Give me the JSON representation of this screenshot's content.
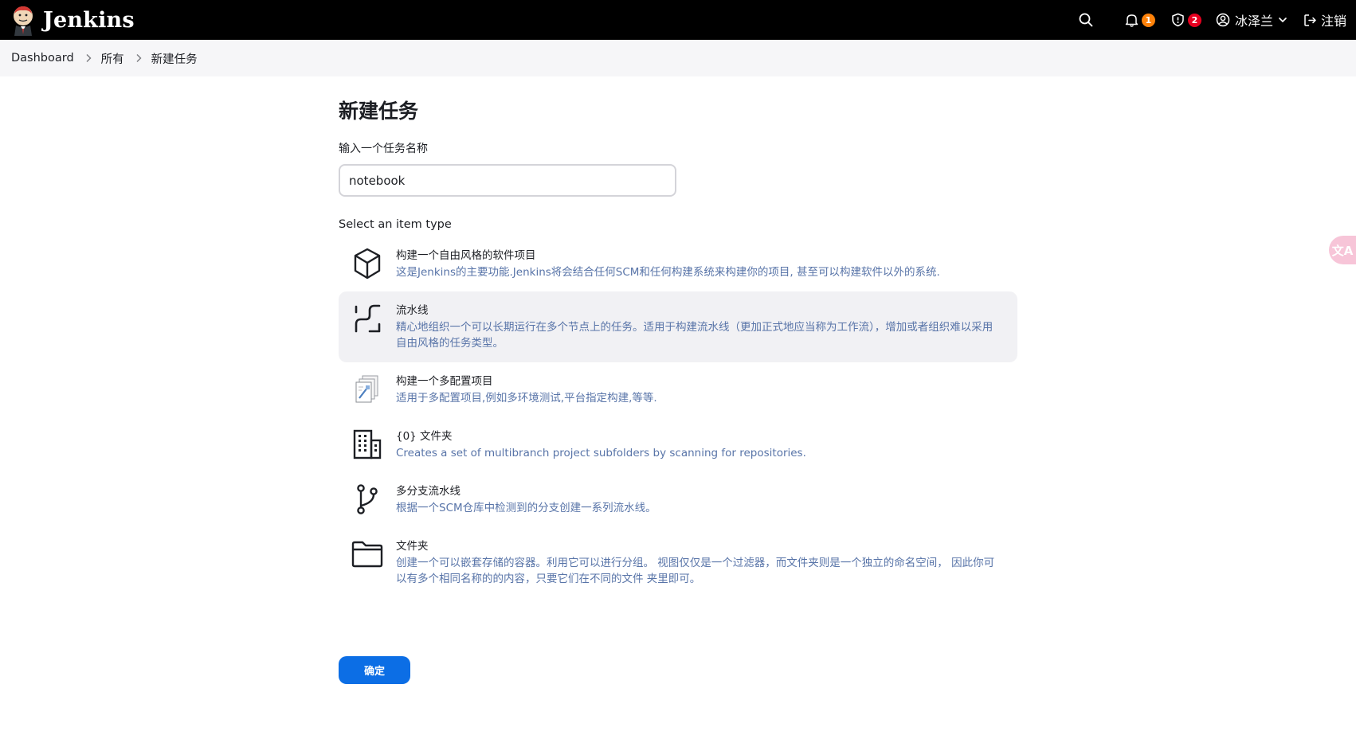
{
  "header": {
    "brand": "Jenkins",
    "notifications_count": "1",
    "security_count": "2",
    "user_name": "冰泽兰",
    "logout_label": "注销"
  },
  "breadcrumb": [
    "Dashboard",
    "所有",
    "新建任务"
  ],
  "main": {
    "title": "新建任务",
    "name_label": "输入一个任务名称",
    "name_value": "notebook",
    "type_label": "Select an item type",
    "items": [
      {
        "icon": "cube-icon",
        "title": "构建一个自由风格的软件项目",
        "desc": "这是Jenkins的主要功能.Jenkins将会结合任何SCM和任何构建系统来构建你的项目, 甚至可以构建软件以外的系统."
      },
      {
        "icon": "pipeline-icon",
        "title": "流水线",
        "desc": "精心地组织一个可以长期运行在多个节点上的任务。适用于构建流水线（更加正式地应当称为工作流），增加或者组织难以采用自由风格的任务类型。",
        "selected": true
      },
      {
        "icon": "multi-config-icon",
        "title": "构建一个多配置项目",
        "desc": "适用于多配置项目,例如多环境测试,平台指定构建,等等."
      },
      {
        "icon": "building-icon",
        "title": "{0} 文件夹",
        "desc": "Creates a set of multibranch project subfolders by scanning for repositories."
      },
      {
        "icon": "branch-icon",
        "title": "多分支流水线",
        "desc": "根据一个SCM仓库中检测到的分支创建一系列流水线。"
      },
      {
        "icon": "folder-icon",
        "title": "文件夹",
        "desc": "创建一个可以嵌套存储的容器。利用它可以进行分组。 视图仅仅是一个过滤器，而文件夹则是一个独立的命名空间， 因此你可以有多个相同名称的的内容，只要它们在不同的文件 夹里即可。"
      }
    ],
    "ok_label": "确定"
  },
  "float_widget": {
    "icon": "translate-icon",
    "label": "文A"
  },
  "colors": {
    "header_bg": "#000000",
    "breadcrumb_bg": "#f6f6f8",
    "accent_button": "#0c6ee5",
    "description_text": "#5874a8",
    "selected_item_bg": "#f1f1f4",
    "badge_orange": "#fe820a",
    "badge_red": "#e6001f"
  }
}
